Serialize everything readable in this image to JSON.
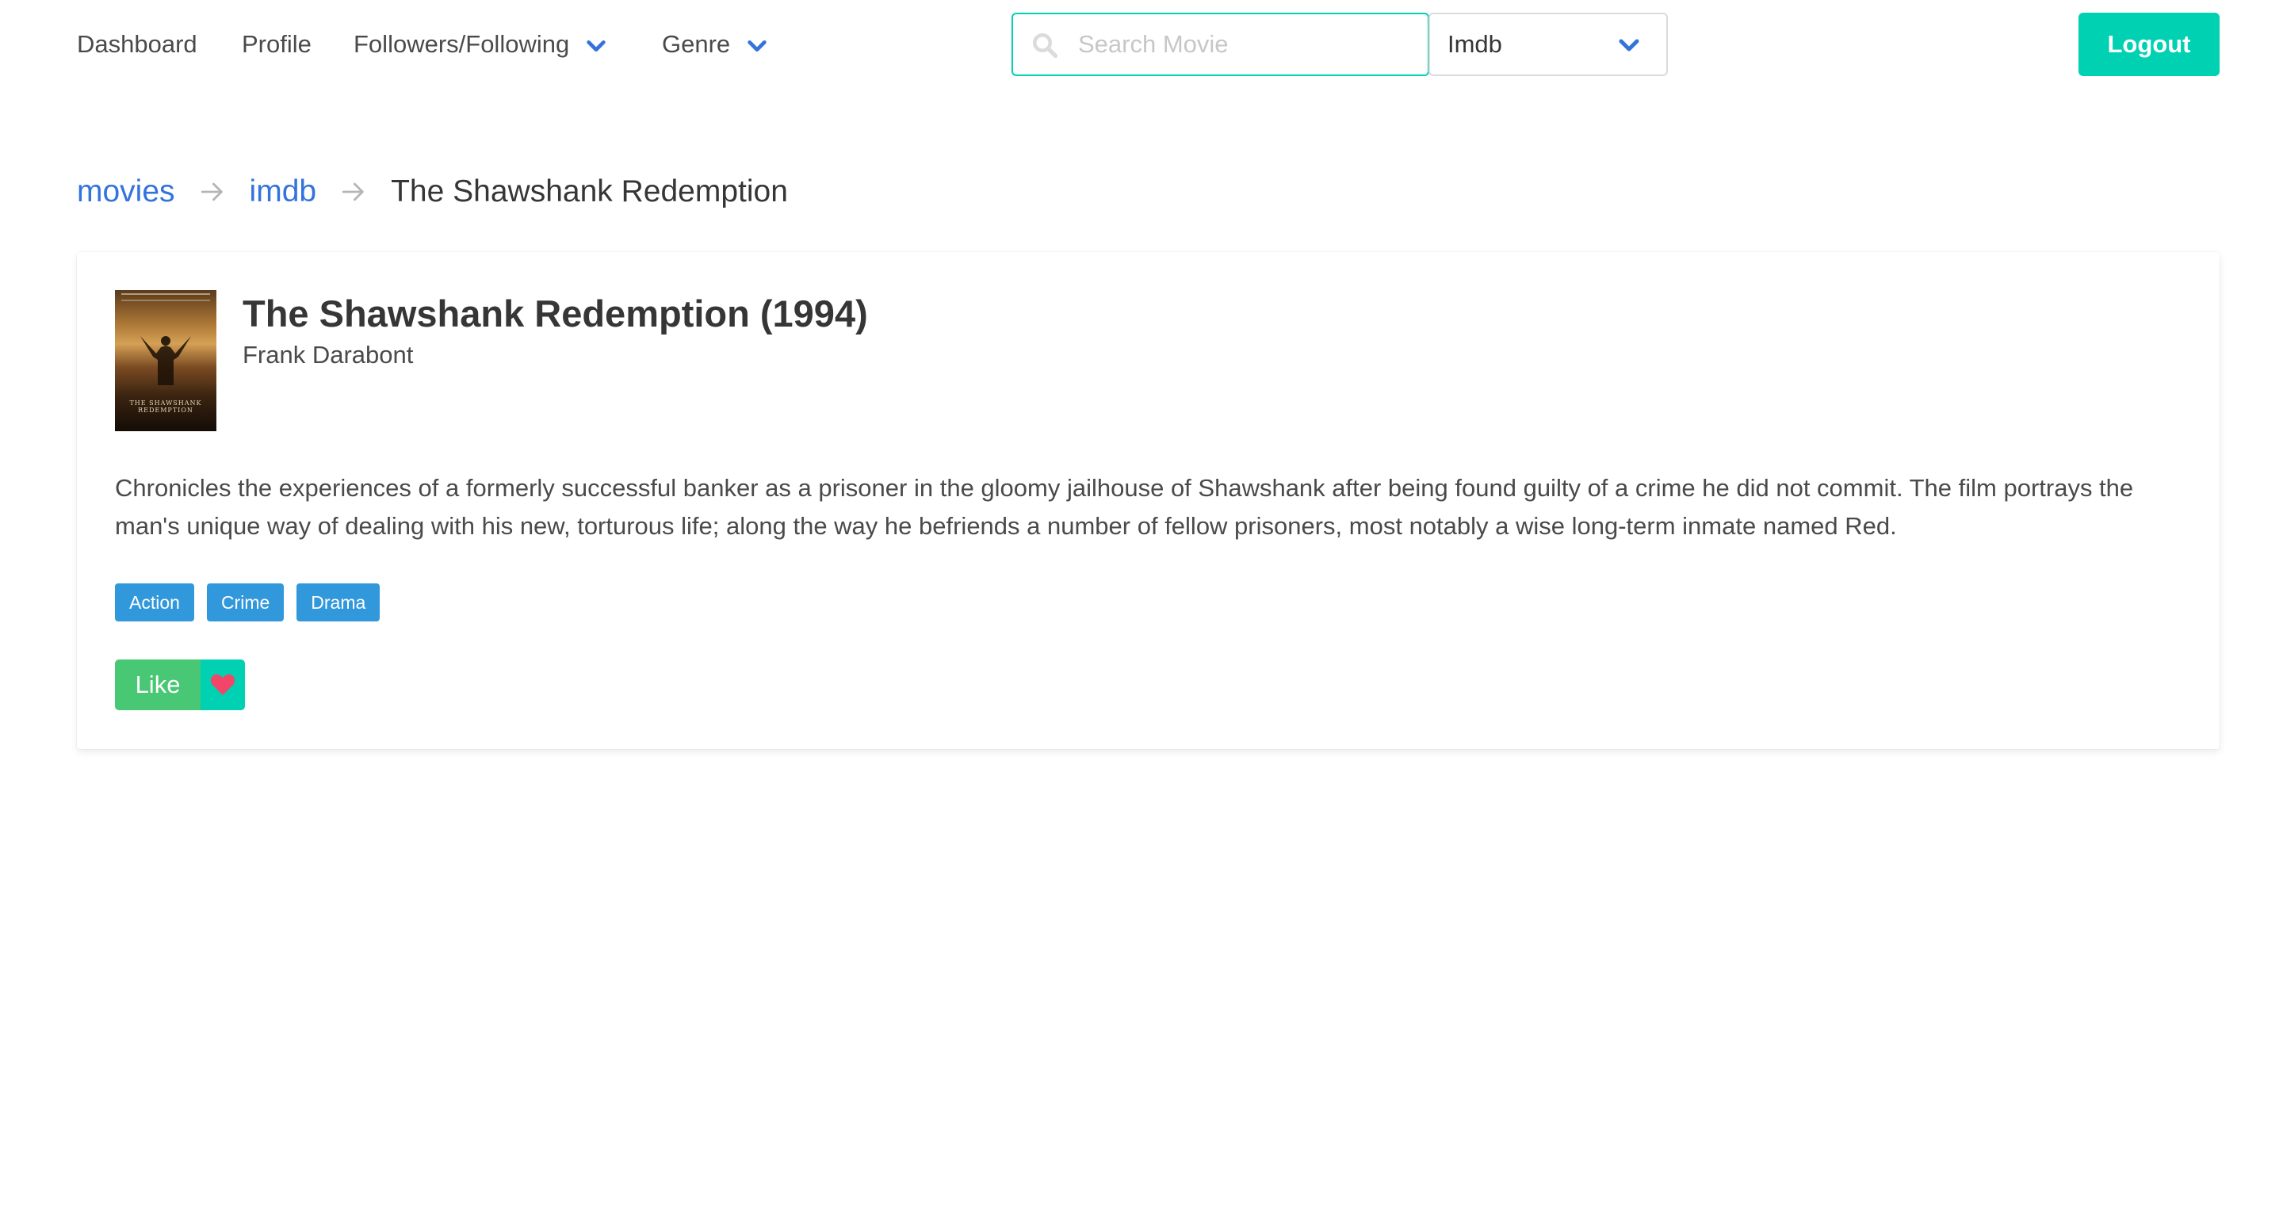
{
  "nav": {
    "items": [
      {
        "label": "Dashboard"
      },
      {
        "label": "Profile"
      },
      {
        "label": "Followers/Following"
      },
      {
        "label": "Genre"
      }
    ],
    "search": {
      "placeholder": "Search Movie",
      "value": ""
    },
    "source_select": {
      "selected": "Imdb"
    },
    "logout_label": "Logout"
  },
  "breadcrumb": {
    "items": [
      {
        "label": "movies"
      },
      {
        "label": "imdb"
      },
      {
        "label": "The Shawshank Redemption"
      }
    ]
  },
  "movie": {
    "title": "The Shawshank Redemption (1994)",
    "director": "Frank Darabont",
    "poster_title": "THE SHAWSHANK REDEMPTION",
    "description": "Chronicles the experiences of a formerly successful banker as a prisoner in the gloomy jailhouse of Shawshank after being found guilty of a crime he did not commit. The film portrays the man's unique way of dealing with his new, torturous life; along the way he befriends a number of fellow prisoners, most notably a wise long-term inmate named Red.",
    "genres": [
      "Action",
      "Crime",
      "Drama"
    ],
    "like_label": "Like"
  },
  "colors": {
    "primary": "#00d1b2",
    "link": "#3273dc",
    "tag": "#3298dc",
    "like": "#48c774",
    "heart": "#f14668"
  },
  "icons": {
    "search": "search-icon",
    "dropdown": "chevron-down-icon",
    "breadcrumb_separator": "arrow-right-icon",
    "like": "heart-icon"
  }
}
